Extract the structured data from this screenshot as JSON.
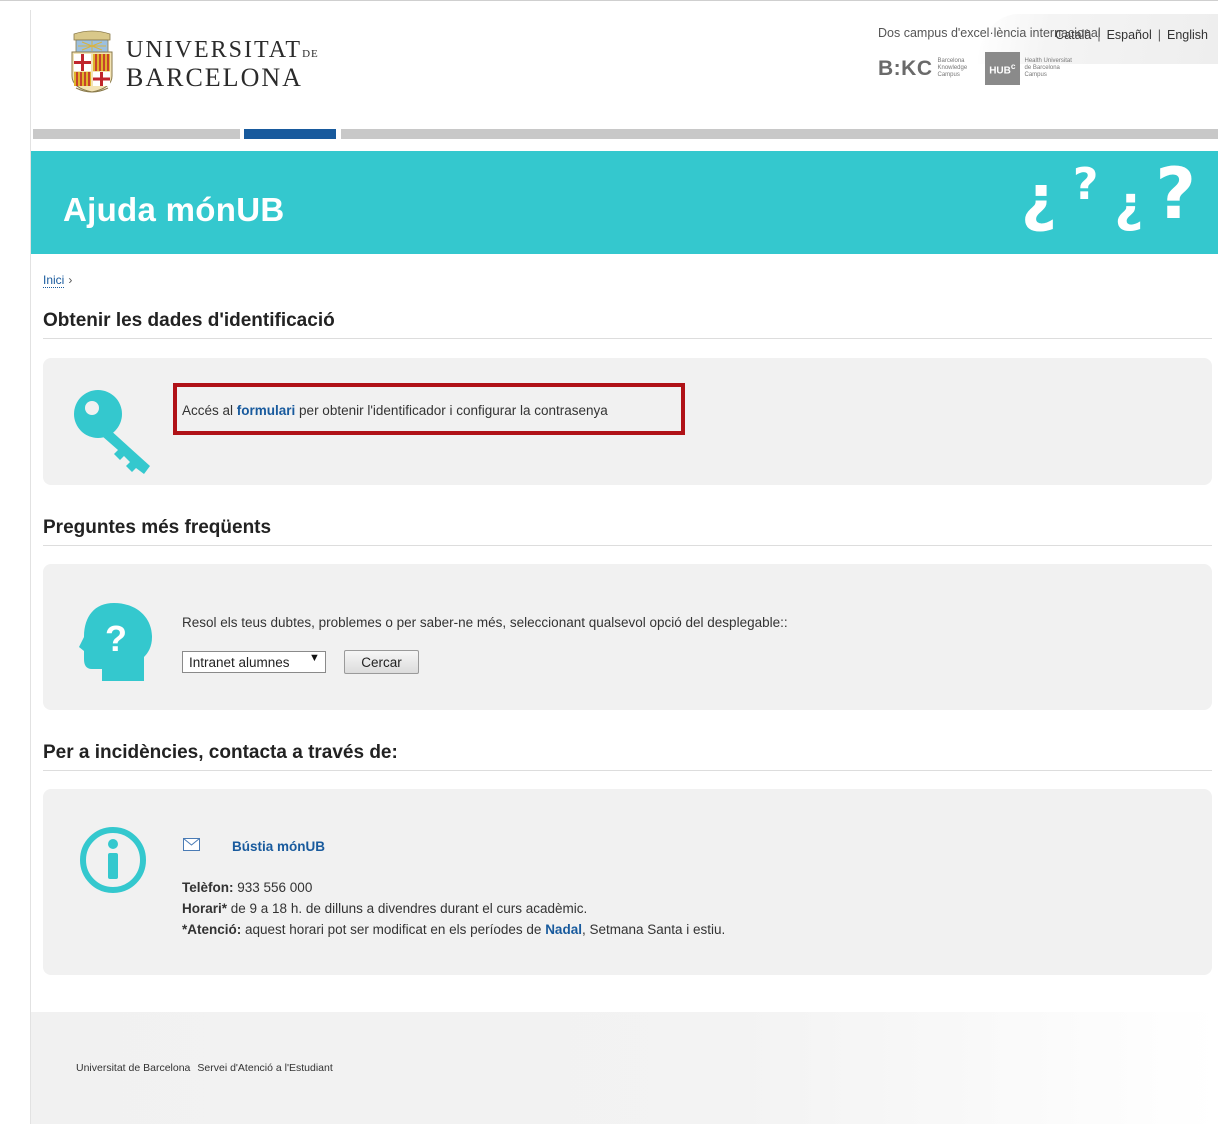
{
  "languages": [
    "Català",
    "Español",
    "English"
  ],
  "logo": {
    "line1": "UNIVERSITAT",
    "line1_suffix": "DE",
    "line2": "BARCELONA"
  },
  "banner": {
    "title": "Ajuda mónUB",
    "decor": [
      "¿",
      "?",
      "¿",
      "?"
    ]
  },
  "breadcrumb": {
    "home": "Inici",
    "separator": "›"
  },
  "section1": {
    "title": "Obtenir les dades d'identificació",
    "icon": "key-icon",
    "text_before": "Accés al ",
    "link": "formulari",
    "text_after": " per obtenir l'identificador i configurar la contrasenya"
  },
  "section2": {
    "title": "Preguntes més freqüents",
    "icon": "question-head-icon",
    "text": "Resol els teus dubtes, problemes o per saber-ne més, seleccionant qualsevol opció del desplegable::",
    "select_value": "Intranet alumnes",
    "button": "Cercar"
  },
  "section3": {
    "title": "Per a incidències, contacta a través de:",
    "icon": "info-icon",
    "mail_link": "Bústia mónUB",
    "phone_label": "Telèfon:",
    "phone": " 933 556 000",
    "hours_label": "Horari*",
    "hours": " de 9 a 18 h. de dilluns a divendres durant el curs acadèmic.",
    "note_label": "*Atenció:",
    "note_before": " aquest horari pot ser modificat en els períodes de ",
    "note_link": "Nadal",
    "note_after": ", Setmana Santa i estiu."
  },
  "footer": {
    "links": [
      "Universitat de Barcelona",
      "Servei d'Atenció a l'Estudiant"
    ],
    "campus_title": "Dos campus d'excel·lència internacional",
    "bkc": "B:KC",
    "bkc_sub": [
      "Barcelona",
      "Knowledge",
      "Campus"
    ],
    "hub": "HUB",
    "hub_sup": "c",
    "hub_sub": [
      "Health Universitat",
      "de Barcelona",
      "Campus"
    ]
  },
  "colors": {
    "accent": "#34c8ce",
    "link": "#185a9d",
    "highlight": "#b01217"
  }
}
